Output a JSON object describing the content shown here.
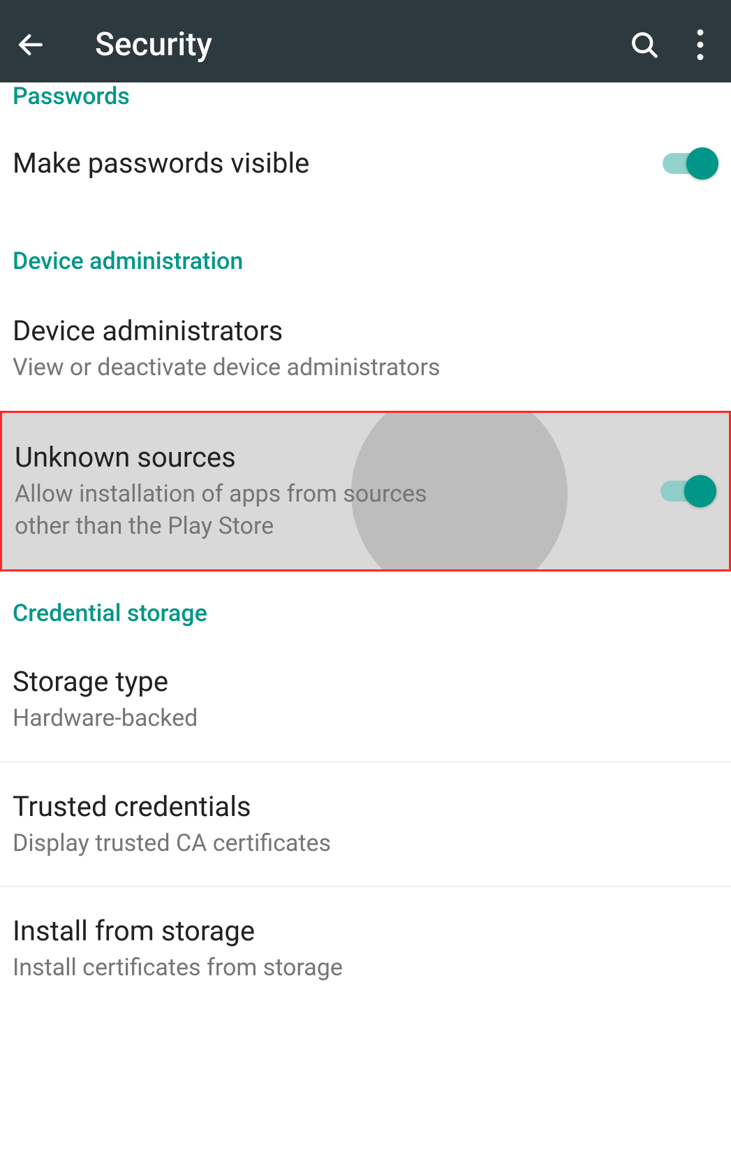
{
  "toolbar": {
    "title": "Security"
  },
  "sections": {
    "passwords": {
      "header": "Passwords",
      "make_visible": {
        "title": "Make passwords visible",
        "on": true
      }
    },
    "device_admin": {
      "header": "Device administration",
      "administrators": {
        "title": "Device administrators",
        "sub": "View or deactivate device administrators"
      },
      "unknown_sources": {
        "title": "Unknown sources",
        "sub": "Allow installation of apps from sources other than the Play Store",
        "on": true
      }
    },
    "credential_storage": {
      "header": "Credential storage",
      "storage_type": {
        "title": "Storage type",
        "sub": "Hardware-backed"
      },
      "trusted_credentials": {
        "title": "Trusted credentials",
        "sub": "Display trusted CA certificates"
      },
      "install_from_storage": {
        "title": "Install from storage",
        "sub": "Install certificates from storage"
      }
    }
  }
}
